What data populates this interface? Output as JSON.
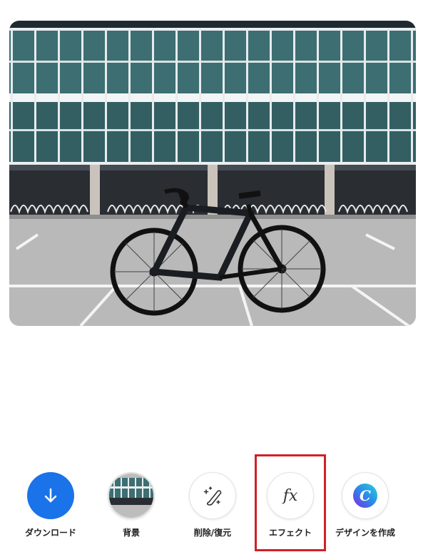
{
  "toolbar": {
    "download_label": "ダウンロード",
    "background_label": "背景",
    "erase_restore_label": "削除/復元",
    "effects_label": "エフェクト",
    "create_design_label": "デザインを作成"
  },
  "icons": {
    "download": "arrow-down-icon",
    "background": "background-thumbnail",
    "erase_restore": "magic-brush-icon",
    "effects": "fx-icon",
    "create_design": "canva-logo-icon"
  },
  "colors": {
    "accent_blue": "#1a73e8",
    "highlight_red": "#d11f26"
  }
}
